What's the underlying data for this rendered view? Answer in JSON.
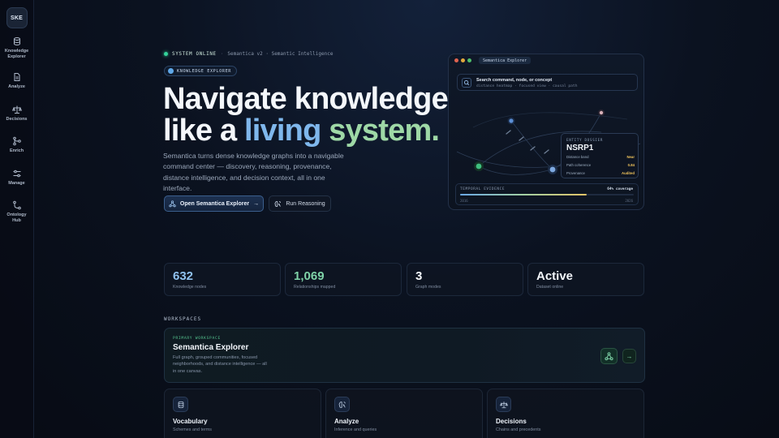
{
  "sidebar": {
    "logo": "SKE",
    "items": [
      {
        "label": "Knowledge Explorer",
        "icon": "database-icon"
      },
      {
        "label": "Analyze",
        "icon": "document-icon"
      },
      {
        "label": "Decisions",
        "icon": "scale-icon"
      },
      {
        "label": "Enrich",
        "icon": "git-merge-icon"
      },
      {
        "label": "Manage",
        "icon": "sliders-icon"
      },
      {
        "label": "Ontology Hub",
        "icon": "git-branch-icon"
      }
    ]
  },
  "hero": {
    "status": "SYSTEM ONLINE",
    "version": "Semantica v2 · Semantic Intelligence",
    "badge": "KNOWLEDGE EXPLORER",
    "title_line1": "Navigate knowledge",
    "title_line2_prefix": "like a ",
    "title_living": "living",
    "title_system": "system.",
    "description": "Semantica turns dense knowledge graphs into a navigable command center — discovery, reasoning, provenance, distance intelligence, and decision context, all in one interface.",
    "primary_button": "Open Semantica Explorer",
    "secondary_button": "Run Reasoning"
  },
  "preview": {
    "window_title": "Semantica Explorer",
    "search_title": "Search command, node, or concept",
    "search_hint": "distance heatmap · focused view · causal path",
    "dossier": {
      "header": "ENTITY DOSSIER",
      "name": "NSRP1",
      "rows": [
        {
          "label": "Distance band",
          "value": "Near"
        },
        {
          "label": "Path coherence",
          "value": "0.84"
        },
        {
          "label": "Provenance",
          "value": "Audited"
        }
      ]
    },
    "temporal": {
      "label": "TEMPORAL EVIDENCE",
      "coverage": "64% coverage",
      "coverage_fraction": 0.73,
      "start_year": "2016",
      "end_year": "2026"
    },
    "colors": {
      "node_blue": "#5c8fd6",
      "node_green": "#3fbf7f",
      "node_pink": "#d7b0b8"
    }
  },
  "stats": [
    {
      "value": "632",
      "label": "Knowledge nodes",
      "color": "#8fc1ee"
    },
    {
      "value": "1,069",
      "label": "Relationships mapped",
      "color": "#7fd3a8"
    },
    {
      "value": "3",
      "label": "Graph modes",
      "color": "#f2f5f9"
    },
    {
      "value": "Active",
      "label": "Dataset online",
      "color": "#f2f5f9"
    }
  ],
  "workspaces": {
    "heading": "WORKSPACES",
    "primary": {
      "tag": "PRIMARY WORKSPACE",
      "title": "Semantica Explorer",
      "description": "Full graph, grouped communities, focused neighborhoods, and distance intelligence — all in one canvas."
    },
    "cards": [
      {
        "title": "Vocabulary",
        "subtitle": "Schemes and terms",
        "icon": "database-icon"
      },
      {
        "title": "Analyze",
        "subtitle": "Inference and queries",
        "icon": "brain-icon"
      },
      {
        "title": "Decisions",
        "subtitle": "Chains and precedents",
        "icon": "scale-icon"
      }
    ]
  }
}
